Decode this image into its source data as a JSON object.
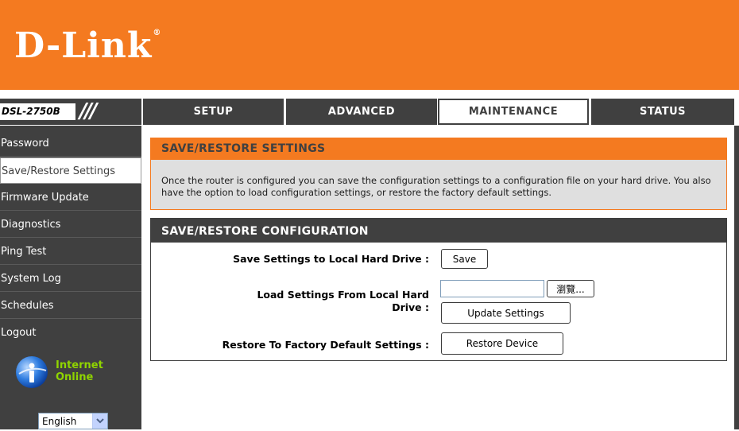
{
  "brand": {
    "logo": "D-Link",
    "registered": "®",
    "model": "DSL-2750B",
    "orange": "#f47a20",
    "dark": "#404040"
  },
  "tabs": [
    {
      "label": "SETUP",
      "active": false
    },
    {
      "label": "ADVANCED",
      "active": false
    },
    {
      "label": "MAINTENANCE",
      "active": true
    },
    {
      "label": "STATUS",
      "active": false
    }
  ],
  "sidebar": {
    "items": [
      {
        "label": "Password"
      },
      {
        "label": "Save/Restore Settings",
        "active": true
      },
      {
        "label": "Firmware Update"
      },
      {
        "label": "Diagnostics"
      },
      {
        "label": "Ping Test"
      },
      {
        "label": "System Log"
      },
      {
        "label": "Schedules"
      },
      {
        "label": "Logout"
      }
    ],
    "status_line1": "Internet",
    "status_line2": "Online",
    "status_icon": "internet-online-icon",
    "language": "English"
  },
  "intro": {
    "title": "SAVE/RESTORE SETTINGS",
    "text": "Once the router is configured you can save the configuration settings to a configuration file on your hard drive. You also have the option to load configuration settings, or restore the factory default settings."
  },
  "config": {
    "title": "SAVE/RESTORE CONFIGURATION",
    "save_label": "Save Settings to Local Hard Drive :",
    "save_button": "Save",
    "load_label_line1": "Load Settings From Local Hard",
    "load_label_line2": "Drive :",
    "file_value": "",
    "browse_button": "瀏覽...",
    "update_button": "Update Settings",
    "restore_label": "Restore To Factory Default Settings :",
    "restore_button": "Restore Device"
  }
}
